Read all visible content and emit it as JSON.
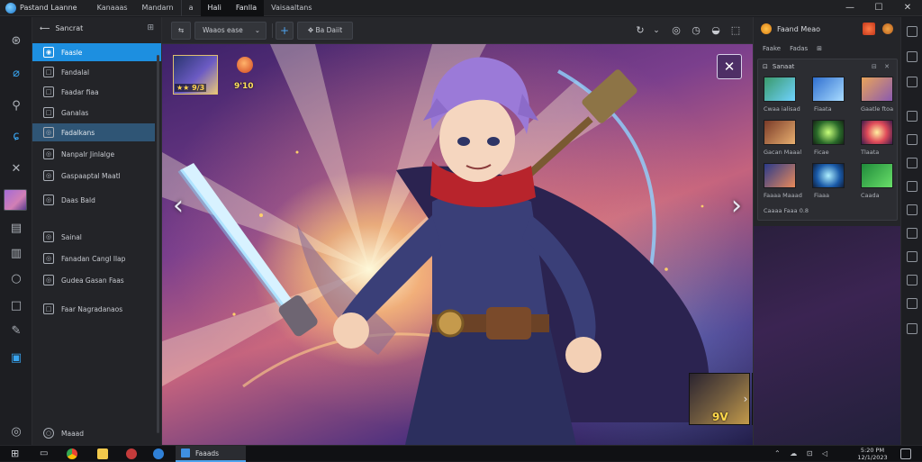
{
  "titlebar": {
    "app_title": "Pastand Laanne",
    "menus": [
      "Kanaaas",
      "Mandarn",
      "a",
      "Hali",
      "Fanlla",
      "Vaisaaltans"
    ],
    "controls": [
      "—",
      "☐",
      "✕"
    ]
  },
  "left_panel": {
    "header": "Sancrat",
    "pin": "⊞",
    "items": [
      {
        "label": "Faasle",
        "icon": "◉"
      },
      {
        "label": "Fandalal",
        "icon": "□"
      },
      {
        "label": "Faadar fiaa",
        "icon": "□"
      },
      {
        "label": "Ganalas",
        "icon": "□"
      },
      {
        "label": "Fadalkans",
        "icon": "◎"
      },
      {
        "label": "Nanpalr Jinlalge",
        "icon": "◎"
      },
      {
        "label": "Gaspaaptal Maatl",
        "icon": "◎"
      },
      {
        "label": "Daas Bald",
        "icon": "◎"
      },
      {
        "label": "Sainal",
        "icon": "◎"
      },
      {
        "label": "Fanadan Cangl llap",
        "icon": "◎"
      },
      {
        "label": "Gudea Gasan Faas",
        "icon": "◎"
      },
      {
        "label": "Faar Nagradanaos",
        "icon": "□"
      }
    ],
    "footer": {
      "label": "Maaad",
      "icon": "○"
    }
  },
  "toolbar": {
    "back_icon": "⇆",
    "dropdown_value": "Waaos ease",
    "dropdown_chevron": "⌄",
    "add_icon": "+",
    "action_label": "✥ Ba Daiit",
    "right_icons": [
      "↻",
      "⌄",
      "◎",
      "◷",
      "◒",
      "⬚"
    ]
  },
  "viewer": {
    "character_level": "★★ 9/3",
    "stat_value": "9'10",
    "share_icon": "✕",
    "prev_icon": "‹",
    "next_icon": "›",
    "filmstrip_level": "9V",
    "filmstrip_next_icon": "›"
  },
  "right_panel": {
    "header": "Faand Meao",
    "tabs": [
      "Faake",
      "Fadas",
      "⊞"
    ],
    "card_title": "Sanaat",
    "card_controls": "⊟ ✕",
    "thumb_labels": [
      "Cwaa ialisad",
      "Fiaata",
      "Gaatle ftoa",
      "Gacan Maaal",
      "Ficae",
      "Tlaata",
      "Faaaa Maaad",
      "Fiaaa",
      "Caada"
    ],
    "card_more": "Caaaa Faaa 0.8"
  },
  "taskbar": {
    "active_app": "Faaads",
    "tray_icons": "⌃ ☁ ⊡ ◁",
    "clock_time": "5:20 PM",
    "clock_date": "12/1/2023"
  }
}
